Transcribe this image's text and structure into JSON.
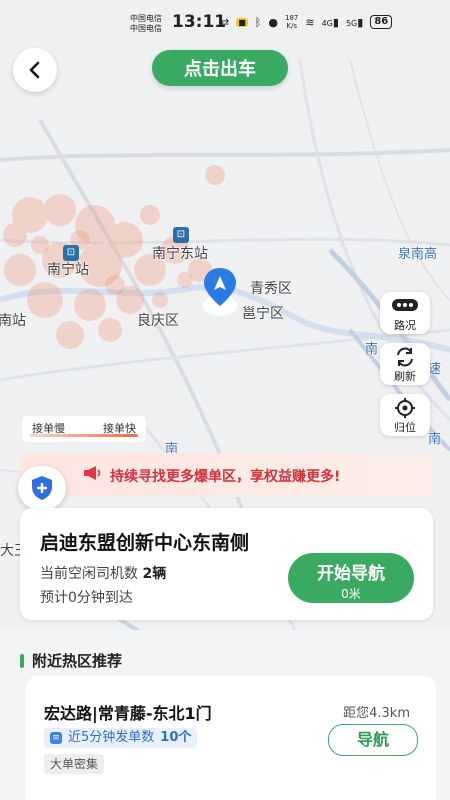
{
  "status_bar": {
    "carrier1": "中国电信",
    "carrier2": "中国电信",
    "time": "13:11",
    "speed_value": "187",
    "speed_unit": "K/s",
    "signal1": "4G",
    "signal2": "5G",
    "battery": "86"
  },
  "header": {
    "depart_label": "点击出车"
  },
  "map": {
    "labels": {
      "nanning_east": "南宁东站",
      "nanning_station": "南宁站",
      "qingxiu": "青秀区",
      "yongning": "邕宁区",
      "liangqing": "良庆区",
      "nan_zhan": "南站",
      "quannan_top": "泉南高",
      "quannan_mid": "南",
      "quannan_right": "南",
      "highway": "速",
      "da_wang": "大王",
      "nan_shan": "南",
      "partial_right": "南"
    }
  },
  "controls": {
    "traffic": "路况",
    "refresh": "刷新",
    "locate": "归位"
  },
  "legend": {
    "slow": "接单慢",
    "fast": "接单快"
  },
  "promo": {
    "text": "持续寻找更多爆单区，享权益赚更多!"
  },
  "destination": {
    "title": "启迪东盟创新中心东南侧",
    "idle_label": "当前空闲司机数",
    "idle_count": "2辆",
    "eta": "预计0分钟到达",
    "nav_label": "开始导航",
    "nav_distance": "0米"
  },
  "nearby": {
    "section_title": "附近热区推荐",
    "items": [
      {
        "name": "宏达路|常青藤-东北1门",
        "distance": "距您4.3km",
        "orders_label": "近5分钟发单数",
        "orders_count": "10个",
        "tag": "大单密集",
        "nav_label": "导航"
      }
    ]
  },
  "colors": {
    "accent": "#3aaa62",
    "promo_red": "#d2323c",
    "pin_blue": "#2a7ae4"
  }
}
